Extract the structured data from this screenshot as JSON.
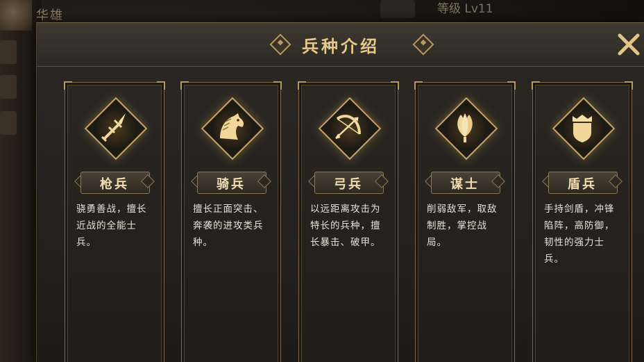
{
  "background": {
    "hero_name": "华雄",
    "level_text": "等级 Lv11"
  },
  "panel": {
    "title": "兵种介绍",
    "close_label": "✕"
  },
  "troops": [
    {
      "label": "枪兵",
      "icon": "spear-icon",
      "description": "骁勇善战，擅长近战的全能士兵。"
    },
    {
      "label": "骑兵",
      "icon": "horse-icon",
      "description": "擅长正面突击、奔袭的进攻类兵种。"
    },
    {
      "label": "弓兵",
      "icon": "bow-icon",
      "description": "以远距离攻击为特长的兵种，擅长暴击、破甲。"
    },
    {
      "label": "谋士",
      "icon": "feather-fan-icon",
      "description": "削弱敌军，取敌制胜，掌控战局。"
    },
    {
      "label": "盾兵",
      "icon": "shield-icon",
      "description": "手持剑盾，冲锋陷阵，高防御，韧性的强力士兵。"
    }
  ],
  "colors": {
    "accent_gold": "#e6c98a",
    "border_gold": "#b69a62"
  }
}
